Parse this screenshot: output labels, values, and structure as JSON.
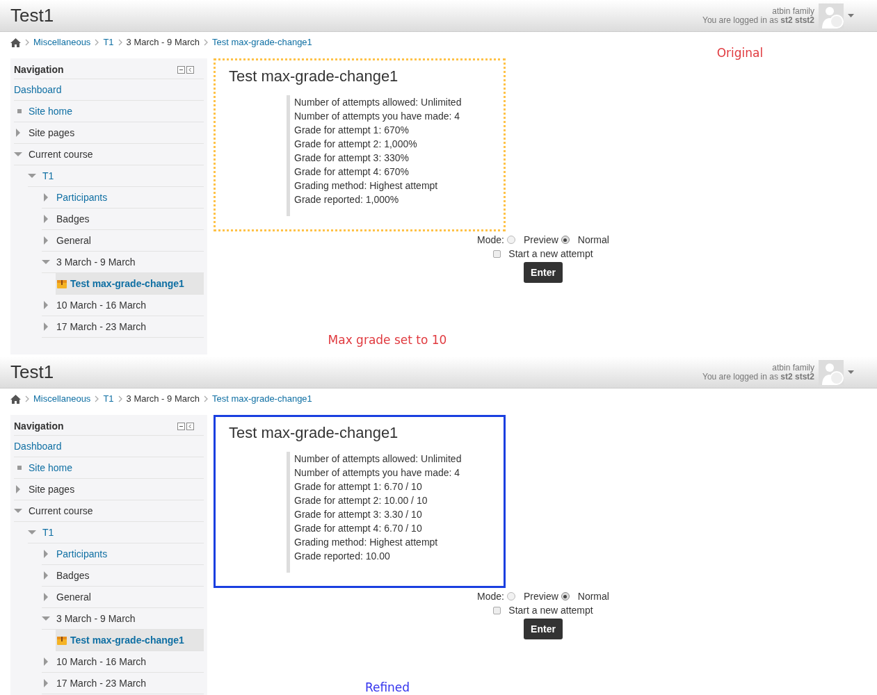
{
  "panels": [
    {
      "header": {
        "title": "Test1",
        "user_name": "atbin family",
        "login_text": "You are logged in as **st2 stst2**"
      },
      "breadcrumb": [
        {
          "label": "Miscellaneous",
          "link": true
        },
        {
          "label": "T1",
          "link": true
        },
        {
          "label": "3 March - 9 March",
          "link": false
        },
        {
          "label": "Test max-grade-change1",
          "link": true
        }
      ],
      "navigation": {
        "title": "Navigation",
        "items": [
          {
            "label": "Dashboard",
            "kind": "root",
            "link": true,
            "selected": false
          },
          {
            "label": "Site home",
            "kind": "leaf",
            "link": true,
            "selected": false
          },
          {
            "label": "Site pages",
            "kind": "branch",
            "expanded": false,
            "link": false,
            "selected": false
          },
          {
            "label": "Current course",
            "kind": "branch",
            "expanded": true,
            "link": false,
            "selected": false,
            "children": [
              {
                "label": "T1",
                "kind": "branch",
                "expanded": true,
                "link": true,
                "selected": false,
                "children": [
                  {
                    "label": "Participants",
                    "kind": "branch",
                    "expanded": false,
                    "link": true,
                    "selected": false
                  },
                  {
                    "label": "Badges",
                    "kind": "branch",
                    "expanded": false,
                    "link": false,
                    "selected": false
                  },
                  {
                    "label": "General",
                    "kind": "branch",
                    "expanded": false,
                    "link": false,
                    "selected": false
                  },
                  {
                    "label": "3 March - 9 March",
                    "kind": "branch",
                    "expanded": true,
                    "link": false,
                    "selected": false,
                    "children": [
                      {
                        "label": "Test max-grade-change1",
                        "kind": "activity",
                        "link": true,
                        "selected": true
                      }
                    ]
                  },
                  {
                    "label": "10 March - 16 March",
                    "kind": "branch",
                    "expanded": false,
                    "link": false,
                    "selected": false
                  },
                  {
                    "label": "17 March - 23 March",
                    "kind": "branch",
                    "expanded": false,
                    "link": false,
                    "selected": false
                  }
                ]
              }
            ]
          }
        ]
      },
      "quiz": {
        "title": "Test max-grade-change1",
        "frame": {
          "kind": "dotted",
          "color": "#ffc247"
        },
        "lines": [
          "Number of attempts allowed: Unlimited",
          "Number of attempts you have made: 4",
          "Grade for attempt 1: 670%",
          "Grade for attempt 2: 1,000%",
          "Grade for attempt 3: 330%",
          "Grade for attempt 4: 670%",
          "Grading method: Highest attempt",
          "Grade reported: 1,000%"
        ]
      },
      "mode": {
        "label": "Mode:",
        "options": [
          {
            "label": "Preview",
            "selected": false
          },
          {
            "label": "Normal",
            "selected": true
          }
        ]
      },
      "new_attempt": {
        "label": "Start a new attempt",
        "checked": false
      },
      "enter_button": "Enter",
      "annotations": [
        {
          "text": "Original",
          "kind": "top",
          "color": "#e0393e"
        },
        {
          "text": "Max grade set to 10",
          "kind": "bottom",
          "color": "#e0393e"
        }
      ]
    },
    {
      "header": {
        "title": "Test1",
        "user_name": "atbin family",
        "login_text": "You are logged in as **st2 stst2**"
      },
      "breadcrumb": [
        {
          "label": "Miscellaneous",
          "link": true
        },
        {
          "label": "T1",
          "link": true
        },
        {
          "label": "3 March - 9 March",
          "link": false
        },
        {
          "label": "Test max-grade-change1",
          "link": true
        }
      ],
      "navigation": {
        "title": "Navigation",
        "items": [
          {
            "label": "Dashboard",
            "kind": "root",
            "link": true,
            "selected": false
          },
          {
            "label": "Site home",
            "kind": "leaf",
            "link": true,
            "selected": false
          },
          {
            "label": "Site pages",
            "kind": "branch",
            "expanded": false,
            "link": false,
            "selected": false
          },
          {
            "label": "Current course",
            "kind": "branch",
            "expanded": true,
            "link": false,
            "selected": false,
            "children": [
              {
                "label": "T1",
                "kind": "branch",
                "expanded": true,
                "link": true,
                "selected": false,
                "children": [
                  {
                    "label": "Participants",
                    "kind": "branch",
                    "expanded": false,
                    "link": true,
                    "selected": false
                  },
                  {
                    "label": "Badges",
                    "kind": "branch",
                    "expanded": false,
                    "link": false,
                    "selected": false
                  },
                  {
                    "label": "General",
                    "kind": "branch",
                    "expanded": false,
                    "link": false,
                    "selected": false
                  },
                  {
                    "label": "3 March - 9 March",
                    "kind": "branch",
                    "expanded": true,
                    "link": false,
                    "selected": false,
                    "children": [
                      {
                        "label": "Test max-grade-change1",
                        "kind": "activity",
                        "link": true,
                        "selected": true
                      }
                    ]
                  },
                  {
                    "label": "10 March - 16 March",
                    "kind": "branch",
                    "expanded": false,
                    "link": false,
                    "selected": false
                  },
                  {
                    "label": "17 March - 23 March",
                    "kind": "branch",
                    "expanded": false,
                    "link": false,
                    "selected": false
                  }
                ]
              }
            ]
          }
        ]
      },
      "quiz": {
        "title": "Test max-grade-change1",
        "frame": {
          "kind": "solid",
          "color": "#1a3fe0"
        },
        "lines": [
          "Number of attempts allowed: Unlimited",
          "Number of attempts you have made: 4",
          "Grade for attempt 1: 6.70 / 10",
          "Grade for attempt 2: 10.00 / 10",
          "Grade for attempt 3: 3.30 / 10",
          "Grade for attempt 4: 6.70 / 10",
          "Grading method: Highest attempt",
          "Grade reported: 10.00"
        ]
      },
      "mode": {
        "label": "Mode:",
        "options": [
          {
            "label": "Preview",
            "selected": false
          },
          {
            "label": "Normal",
            "selected": true
          }
        ]
      },
      "new_attempt": {
        "label": "Start a new attempt",
        "checked": false
      },
      "enter_button": "Enter",
      "annotations": [
        {
          "text": "Refined",
          "kind": "bottom",
          "color": "#3333ee"
        }
      ]
    }
  ]
}
